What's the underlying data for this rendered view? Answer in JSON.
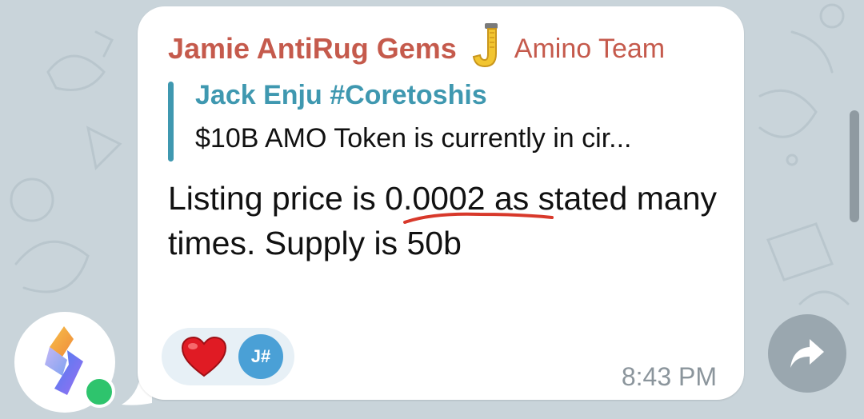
{
  "message": {
    "sender_name": "Jamie AntiRug Gems",
    "sender_emoji": "J",
    "sender_role": "Amino Team",
    "reply": {
      "author": "Jack Enju #Coretoshis",
      "text": "$10B AMO Token is currently in cir..."
    },
    "body_before": "Listing price is ",
    "body_highlight": "0.0002",
    "body_after": " as stated many times. Supply is 50b",
    "reactions": [
      {
        "emoji": "heart-icon",
        "reactor_initials": "J#"
      }
    ],
    "time": "8:43 PM"
  },
  "colors": {
    "sender": "#c55a4c",
    "reply_accent": "#3f98b0",
    "background": "#c9d4da",
    "online": "#2ec46d",
    "annotation_underline": "#d8392b"
  },
  "icons": {
    "forward": "forward-arrow-icon",
    "avatar": "app-logo-icon"
  }
}
